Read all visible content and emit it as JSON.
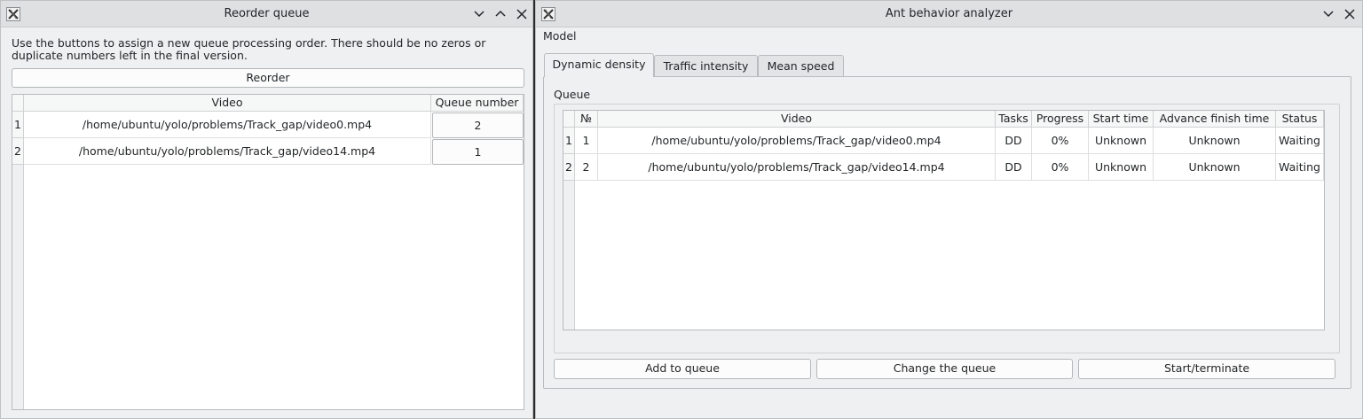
{
  "reorder_window": {
    "title": "Reorder queue",
    "instructions": "Use the buttons to assign a new queue processing order. There should be no zeros or duplicate numbers left in the final version.",
    "reorder_button": "Reorder",
    "table": {
      "headers": [
        "Video",
        "Queue number"
      ],
      "rows": [
        {
          "row_header": "1",
          "video": "/home/ubuntu/yolo/problems/Track_gap/video0.mp4",
          "queue_number": "2"
        },
        {
          "row_header": "2",
          "video": "/home/ubuntu/yolo/problems/Track_gap/video14.mp4",
          "queue_number": "1"
        }
      ]
    }
  },
  "main_window": {
    "title": "Ant behavior analyzer",
    "menu": [
      "Model"
    ],
    "tabs": [
      "Dynamic density",
      "Traffic intensity",
      "Mean speed"
    ],
    "active_tab": "Dynamic density",
    "queue_label": "Queue",
    "table": {
      "headers": [
        "№",
        "Video",
        "Tasks",
        "Progress",
        "Start time",
        "Advance finish time",
        "Status"
      ],
      "rows": [
        {
          "row_header": "1",
          "num": "1",
          "video": "/home/ubuntu/yolo/problems/Track_gap/video0.mp4",
          "tasks": "DD",
          "progress": "0%",
          "start_time": "Unknown",
          "finish_time": "Unknown",
          "status": "Waiting"
        },
        {
          "row_header": "2",
          "num": "2",
          "video": "/home/ubuntu/yolo/problems/Track_gap/video14.mp4",
          "tasks": "DD",
          "progress": "0%",
          "start_time": "Unknown",
          "finish_time": "Unknown",
          "status": "Waiting"
        }
      ]
    },
    "buttons": {
      "add": "Add to queue",
      "change": "Change the queue",
      "start": "Start/terminate"
    }
  },
  "icons": {
    "app": "x-app-icon",
    "minimize": "chevron-down-icon",
    "maximize": "chevron-up-icon",
    "close": "close-icon"
  }
}
